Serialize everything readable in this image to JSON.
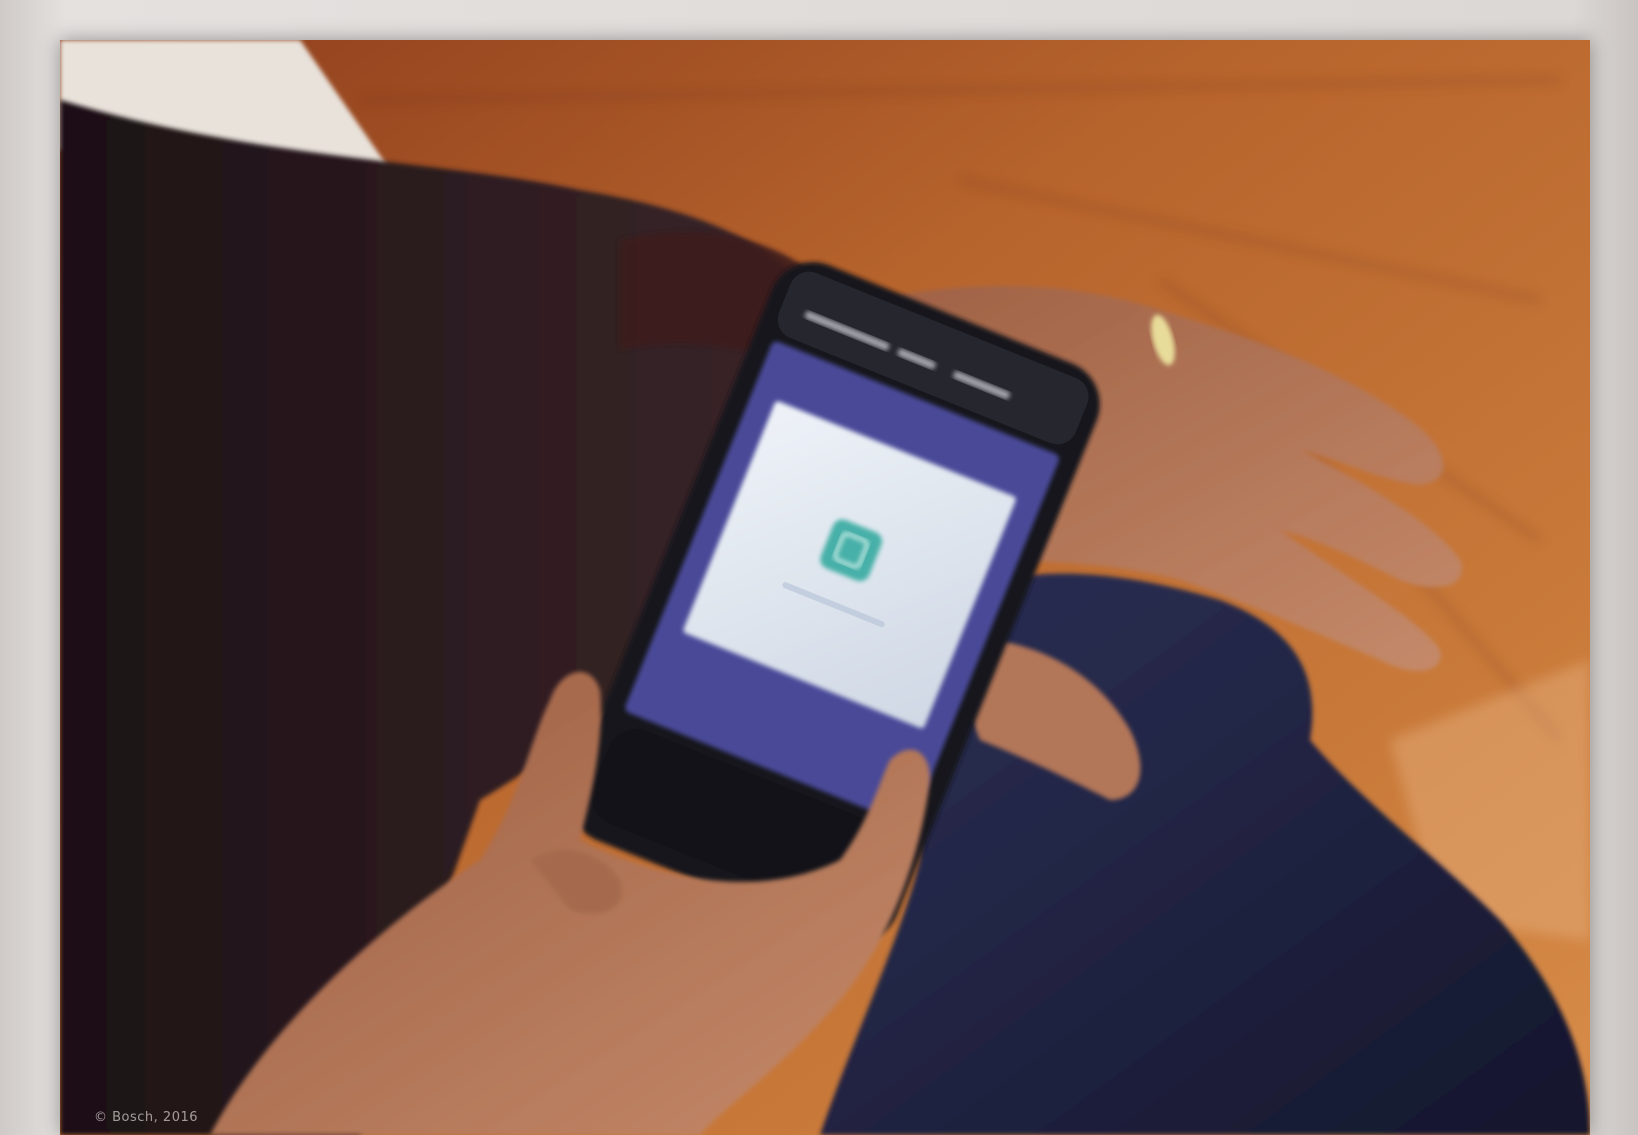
{
  "image": {
    "description_icons": [
      "phone-app-icon",
      "ring-icon"
    ],
    "colors": {
      "table": "#b1602c",
      "table_dark": "#8c4420",
      "sleeve": "#2a1a1f",
      "glove": "#1f2240",
      "phone_body": "#1b1b22",
      "phone_screen_frame": "#4b4a9a",
      "phone_screen": "#dfe6ee",
      "app_icon": "#46b0a8",
      "skin": "#b5775a"
    },
    "caption": "© Bosch, 2016"
  }
}
